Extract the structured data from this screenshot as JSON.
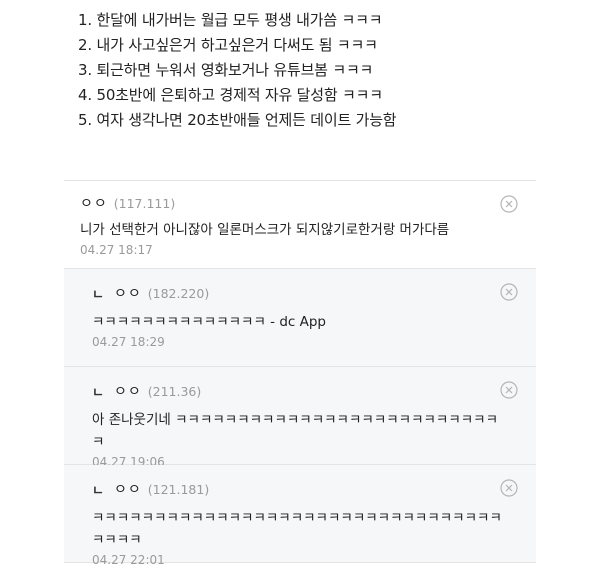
{
  "list_items": [
    "1. 한달에 내가버는 월급 모두 평생 내가씀 ㅋㅋㅋ",
    "2. 내가 사고싶은거 하고싶은거 다써도 됨 ㅋㅋㅋ",
    "3. 퇴근하면 누워서 영화보거나 유튜브봄 ㅋㅋㅋ",
    "4. 50초반에 은퇴하고 경제적 자유 달성함 ㅋㅋㅋ",
    "5. 여자 생각나면 20초반애들 언제든 데이트 가능함"
  ],
  "comments": [
    {
      "nick": "ㅇㅇ",
      "ip": "(117.111)",
      "text": "니가 선택한거 아니잖아 일론머스크가 되지않기로한거랑 머가다름",
      "time": "04.27 18:17"
    }
  ],
  "replies": [
    {
      "mark": "ㄴ",
      "nick": "ㅇㅇ",
      "ip": "(182.220)",
      "text": "ㅋㅋㅋㅋㅋㅋㅋㅋㅋㅋㅋㅋㅋㅋ - dc App",
      "time": "04.27 18:29"
    },
    {
      "mark": "ㄴ",
      "nick": "ㅇㅇ",
      "ip": "(211.36)",
      "text": "아 존나웃기네 ㅋㅋㅋㅋㅋㅋㅋㅋㅋㅋㅋㅋㅋㅋㅋㅋㅋㅋㅋㅋㅋㅋㅋㅋㅋㅋㅋ",
      "time": "04.27 19:06"
    },
    {
      "mark": "ㄴ",
      "nick": "ㅇㅇ",
      "ip": "(121.181)",
      "text": "ㅋㅋㅋㅋㅋㅋㅋㅋㅋㅋㅋㅋㅋㅋㅋㅋㅋㅋㅋㅋㅋㅋㅋㅋㅋㅋㅋㅋㅋㅋㅋㅋㅋㅋㅋㅋㅋ",
      "time": "04.27 22:01"
    }
  ],
  "icons": {
    "delete": "circle-x-icon"
  },
  "colors": {
    "reply_bg": "#f6f7f9",
    "meta_gray": "#9a9a9a",
    "divider": "#e4e4e4"
  }
}
